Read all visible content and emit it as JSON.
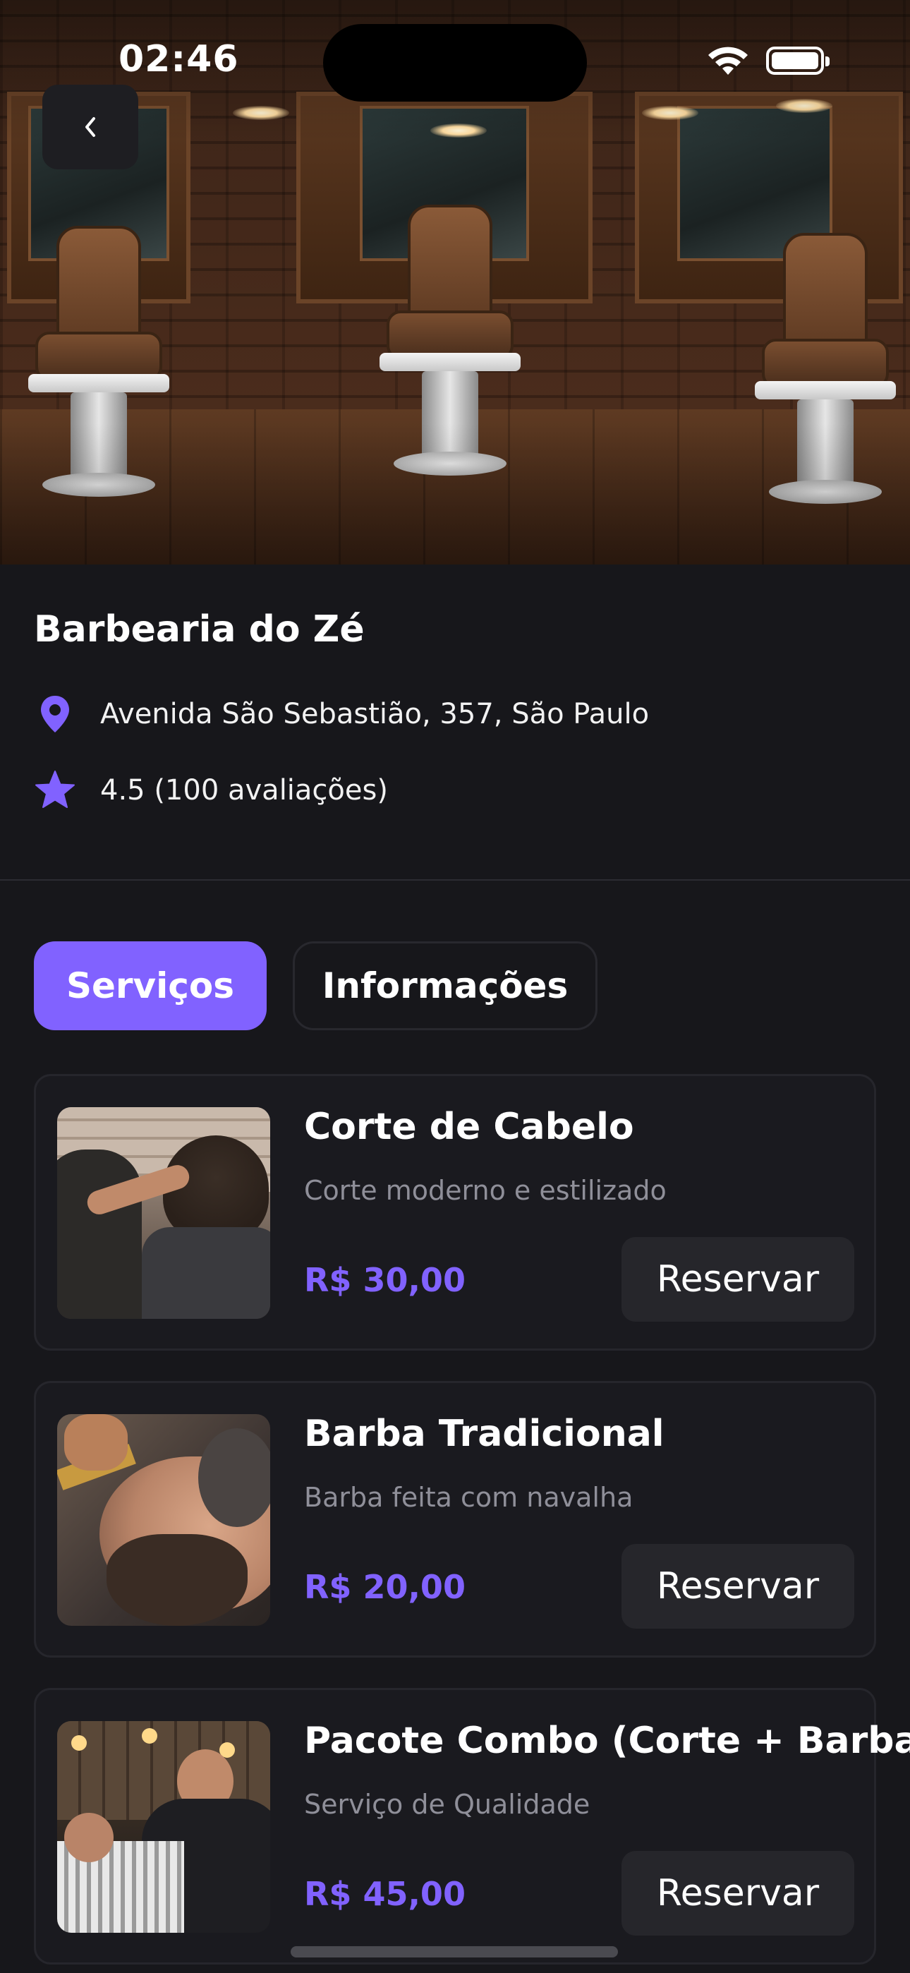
{
  "status_bar": {
    "time": "02:46"
  },
  "shop": {
    "name": "Barbearia do Zé",
    "address": "Avenida São Sebastião, 357, São Paulo",
    "rating": "4.5 (100 avaliações)"
  },
  "tabs": [
    {
      "label": "Serviços",
      "active": true
    },
    {
      "label": "Informações",
      "active": false
    }
  ],
  "services": [
    {
      "title": "Corte de Cabelo",
      "description": "Corte moderno e estilizado",
      "price": "R$ 30,00",
      "button": "Reservar"
    },
    {
      "title": "Barba Tradicional",
      "description": "Barba feita com navalha",
      "price": "R$ 20,00",
      "button": "Reservar"
    },
    {
      "title": "Pacote Combo (Corte + Barba)",
      "description": "Serviço de Qualidade",
      "price": "R$ 45,00",
      "button": "Reservar"
    }
  ],
  "colors": {
    "background": "#17171b",
    "accent": "#8162ff",
    "card": "#1a1a1f",
    "muted_text": "#8f8f99"
  },
  "icons": {
    "back": "chevron-left-icon",
    "location": "map-pin-icon",
    "rating": "star-icon"
  }
}
